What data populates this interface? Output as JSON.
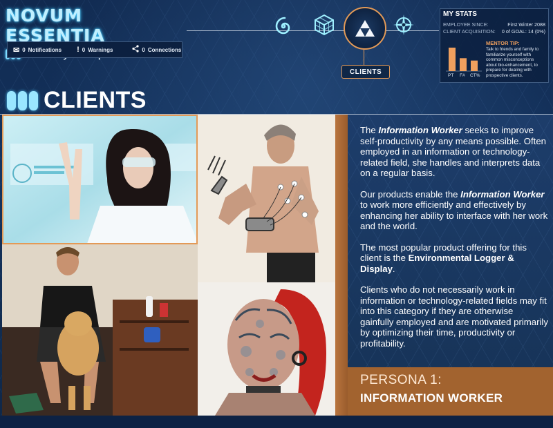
{
  "brand": {
    "title": "NOVUM ESSENTIA",
    "tagline": "create your optimal self"
  },
  "notifications": [
    {
      "icon": "envelope-icon",
      "count": "0",
      "label": "Notifications"
    },
    {
      "icon": "exclamation-icon",
      "count": "0",
      "label": "Warnings"
    },
    {
      "icon": "share-icon",
      "count": "0",
      "label": "Connections"
    }
  ],
  "nav": {
    "items": [
      {
        "name": "spiral-nav-icon",
        "glyph": "◎"
      },
      {
        "name": "cube-nav-icon",
        "glyph": "▦"
      },
      {
        "name": "triforce-nav-icon",
        "glyph": "▲"
      },
      {
        "name": "compass-nav-icon",
        "glyph": "✲"
      }
    ],
    "active_label": "CLIENTS"
  },
  "stats": {
    "title": "MY STATS",
    "employee_since_label": "EMPLOYEE SINCE:",
    "employee_since_value": "First Winter 2088",
    "client_acq_label": "CLIENT ACQUISITION:",
    "client_acq_value": "0 of GOAL: 14 (0%)",
    "chart_labels": [
      "PT",
      "F#",
      "CT%"
    ],
    "chart_values": [
      1.0,
      0.55,
      0.45
    ],
    "mentor_title": "MENTOR TIP:",
    "mentor_text": "Talk to friends and family to familiarize yourself with common misconceptions about bio-enhancement, to prepare for dealing with prospective clients."
  },
  "section": {
    "title": "CLIENTS"
  },
  "photos": [
    {
      "name": "photo-woman-interface",
      "caption": ""
    },
    {
      "name": "photo-man-cybernetic-arm",
      "caption": ""
    },
    {
      "name": "photo-man-with-dog",
      "caption": ""
    },
    {
      "name": "photo-woman-body-mod",
      "caption": ""
    }
  ],
  "description": {
    "p1_pre": "The ",
    "p1_em": "Information Worker",
    "p1_post": " seeks to improve self-productivity by any means possible. Often employed in an information or technology-related field, she handles and interprets data on a regular basis.",
    "p2_pre": "Our products enable the ",
    "p2_em": "Information Worker",
    "p2_post": " to work more efficiently and effectively by enhancing her ability to interface with her work and the world.",
    "p3_pre": "The most popular product offering for this client is the ",
    "p3_strong": "Environmental Logger & Display",
    "p3_post": ".",
    "p4": "Clients who do not necessarily work in information or technology-related fields may fit into this category if they are otherwise gainfully employed and are motivated primarily by optimizing their time, productivity or profitability."
  },
  "persona": {
    "number": "PERSONA 1:",
    "name": "INFORMATION WORKER"
  },
  "colors": {
    "accent": "#e39a57",
    "panel_brown": "#a2632f",
    "background": "#15345f",
    "glow": "#7fdcff"
  }
}
